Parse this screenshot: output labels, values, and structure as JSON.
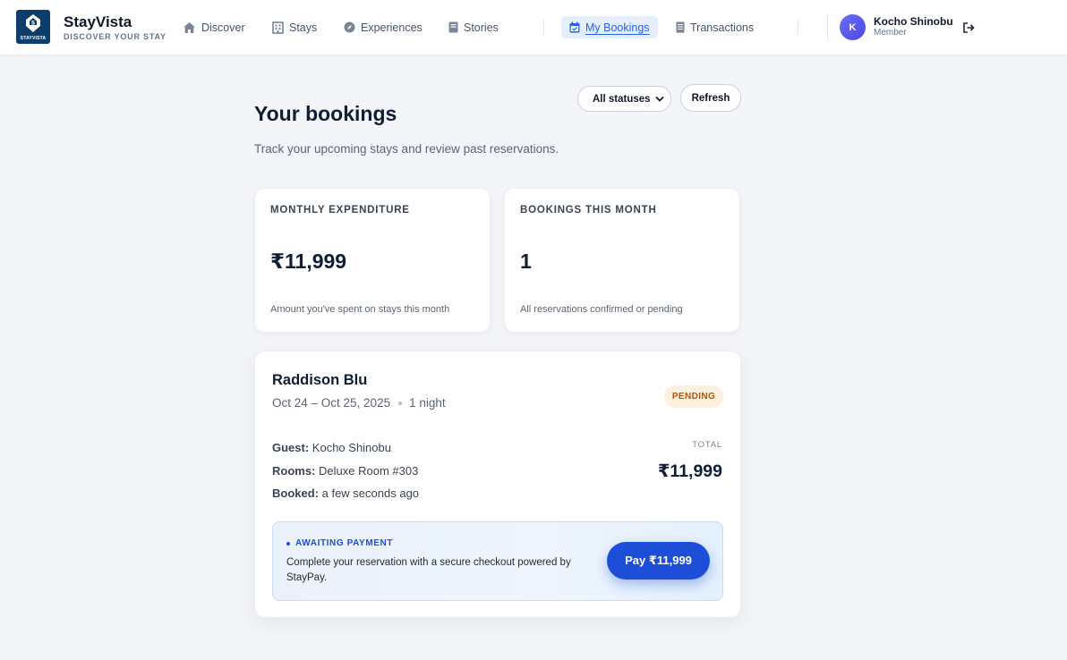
{
  "header": {
    "brand_name": "StayVista",
    "brand_tagline": "DISCOVER YOUR STAY",
    "logo_text": "STAYVISTA",
    "nav": [
      {
        "label": "Discover",
        "icon": "home-icon"
      },
      {
        "label": "Stays",
        "icon": "building-icon"
      },
      {
        "label": "Experiences",
        "icon": "compass-icon"
      },
      {
        "label": "Stories",
        "icon": "book-icon"
      },
      {
        "label": "My Bookings",
        "icon": "calendar-icon",
        "active": true
      },
      {
        "label": "Transactions",
        "icon": "receipt-icon"
      }
    ],
    "user": {
      "initial": "K",
      "name": "Kocho Shinobu",
      "role": "Member"
    }
  },
  "page": {
    "title": "Your bookings",
    "subtitle": "Track your upcoming stays and review past reservations.",
    "filter": {
      "selected": "All statuses"
    },
    "refresh_label": "Refresh"
  },
  "stats": [
    {
      "label": "MONTHLY EXPENDITURE",
      "value": "₹11,999",
      "note": "Amount you've spent on stays this month"
    },
    {
      "label": "BOOKINGS THIS MONTH",
      "value": "1",
      "note": "All reservations confirmed or pending"
    }
  ],
  "booking": {
    "hotel": "Raddison Blu",
    "dates": "Oct 24 – Oct 25, 2025",
    "nights": "1 night",
    "status": "PENDING",
    "guest_label": "Guest:",
    "guest": "Kocho Shinobu",
    "rooms_label": "Rooms:",
    "rooms": "Deluxe Room #303",
    "booked_label": "Booked:",
    "booked": "a few seconds ago",
    "total_label": "TOTAL",
    "total": "₹11,999",
    "payment": {
      "status": "AWAITING PAYMENT",
      "description": "Complete your reservation with a secure checkout powered by StayPay.",
      "button": "Pay ₹11,999"
    }
  },
  "colors": {
    "accent": "#2563eb",
    "brand": "#0c3d6b",
    "pending_bg": "#fdf0dc",
    "pending_text": "#b45309",
    "pay_button": "#1d4ed8"
  }
}
